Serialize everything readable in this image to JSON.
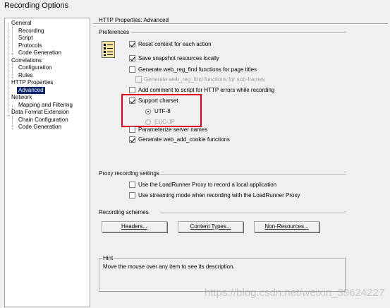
{
  "window": {
    "title": "Recording Options"
  },
  "tree": {
    "items": [
      {
        "label": "General",
        "level": 0
      },
      {
        "label": "Recording",
        "level": 1
      },
      {
        "label": "Script",
        "level": 1
      },
      {
        "label": "Protocols",
        "level": 1
      },
      {
        "label": "Code Generation",
        "level": 1
      },
      {
        "label": "Correlations",
        "level": 0
      },
      {
        "label": "Configuration",
        "level": 1
      },
      {
        "label": "Rules",
        "level": 1
      },
      {
        "label": "HTTP Properties",
        "level": 0
      },
      {
        "label": "Advanced",
        "level": 1,
        "selected": true
      },
      {
        "label": "Network",
        "level": 0
      },
      {
        "label": "Mapping and Filtering",
        "level": 1
      },
      {
        "label": "Data Format Extension",
        "level": 0
      },
      {
        "label": "Chain Configuration",
        "level": 1
      },
      {
        "label": "Code Generation",
        "level": 1
      }
    ]
  },
  "panel": {
    "title": "HTTP Properties: Advanced",
    "preferences_label": "Preferences",
    "options": {
      "reset_context": {
        "label": "Reset context for each action",
        "checked": true
      },
      "save_snapshot": {
        "label": "Save snapshot resources locally",
        "checked": true
      },
      "web_reg_find": {
        "label": "Generate web_reg_find functions for page titles",
        "checked": false
      },
      "web_reg_find_sub": {
        "label": "Generate web_reg_find functions for sub-frames",
        "checked": false,
        "disabled": true
      },
      "add_comment": {
        "label": "Add comment to script for HTTP errors while recording",
        "checked": false
      },
      "support_charset": {
        "label": "Support charset",
        "checked": true
      },
      "utf8": {
        "label": "UTF-8",
        "selected": true
      },
      "eucjp": {
        "label": "EUC-JP",
        "selected": false,
        "disabled": true
      },
      "parameterize": {
        "label": "Parameterize server names",
        "checked": false
      },
      "web_add_cookie": {
        "label": "Generate web_add_cookie functions",
        "checked": true
      }
    },
    "proxy": {
      "label": "Proxy recording settings",
      "use_proxy": {
        "label": "Use the LoadRunner Proxy to record a local application",
        "checked": false
      },
      "streaming": {
        "label": "Use streaming mode when recording with the LoadRunner Proxy",
        "checked": false
      }
    },
    "schemes": {
      "label": "Recording schemes",
      "headers": "Headers...",
      "content_types": "Content Types...",
      "non_resources": "Non-Resources..."
    },
    "hint": {
      "label": "Hint",
      "text": "Move the mouse over any item to see its description."
    }
  },
  "watermark": "https://blog.csdn.net/weixin_39624227",
  "colors": {
    "selection": "#0a246a",
    "highlight": "#e0001a"
  }
}
